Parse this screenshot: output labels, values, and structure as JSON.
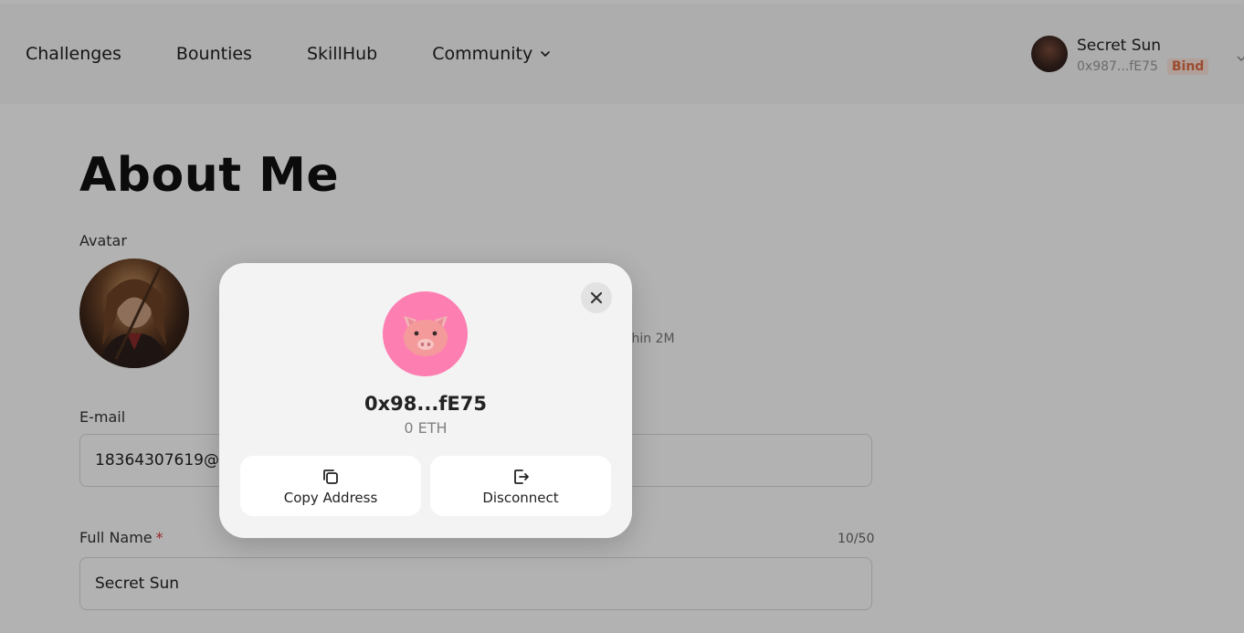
{
  "nav": {
    "items": [
      {
        "label": "Challenges"
      },
      {
        "label": "Bounties"
      },
      {
        "label": "SkillHub"
      },
      {
        "label": "Community",
        "has_dropdown": true
      }
    ]
  },
  "user": {
    "name": "Secret Sun",
    "address": "0x987...fE75",
    "bind_label": "Bind"
  },
  "page": {
    "title": "About Me",
    "avatar_label": "Avatar",
    "avatar_hint": "thin 2M",
    "email_label": "E-mail",
    "email_value": "18364307619@1",
    "fullname_label": "Full Name",
    "fullname_required": "*",
    "fullname_counter": "10/50",
    "fullname_value": "Secret Sun"
  },
  "modal": {
    "address": "0x98...fE75",
    "balance": "0 ETH",
    "copy_label": "Copy Address",
    "disconnect_label": "Disconnect",
    "avatar_icon": "pig-icon",
    "colors": {
      "avatar_bg": "#fd7fb2",
      "pig_face": "#f59a9a"
    }
  },
  "colors": {
    "bind_text": "#e06d47",
    "bind_bg": "#fde6dc",
    "required": "#d9363e"
  }
}
